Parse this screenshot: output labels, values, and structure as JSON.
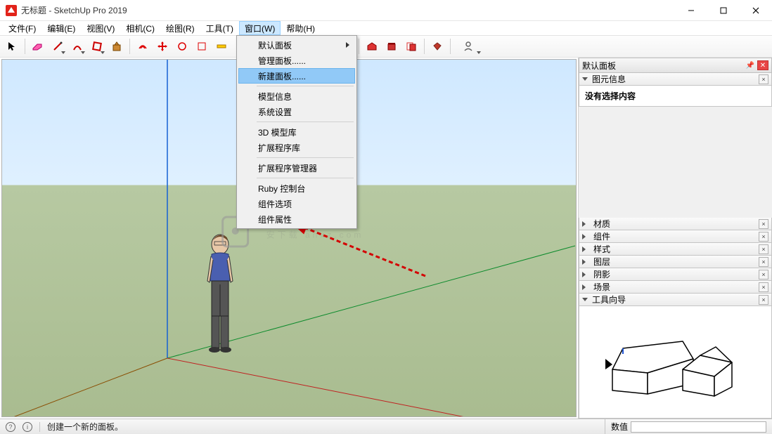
{
  "title": "无标题 - SketchUp Pro 2019",
  "menubar": [
    "文件(F)",
    "编辑(E)",
    "视图(V)",
    "相机(C)",
    "绘图(R)",
    "工具(T)",
    "窗口(W)",
    "帮助(H)"
  ],
  "menubar_open_index": 6,
  "dropdown": {
    "items": [
      {
        "label": "默认面板",
        "submenu": true
      },
      {
        "label": "管理面板......"
      },
      {
        "label": "新建面板......",
        "hover": true
      },
      {
        "sep": true
      },
      {
        "label": "模型信息"
      },
      {
        "label": "系统设置"
      },
      {
        "sep": true
      },
      {
        "label": "3D 模型库"
      },
      {
        "label": "扩展程序库"
      },
      {
        "sep": true
      },
      {
        "label": "扩展程序管理器"
      },
      {
        "sep": true
      },
      {
        "label": "Ruby 控制台"
      },
      {
        "label": "组件选项"
      },
      {
        "label": "组件属性"
      }
    ]
  },
  "panels": {
    "tray_title": "默认面板",
    "entity_info": {
      "title": "图元信息",
      "body": "没有选择内容"
    },
    "sections": [
      {
        "title": "材质"
      },
      {
        "title": "组件"
      },
      {
        "title": "样式"
      },
      {
        "title": "图层"
      },
      {
        "title": "阴影"
      },
      {
        "title": "场景"
      }
    ],
    "instructor": {
      "title": "工具向导"
    }
  },
  "statusbar": {
    "hint": "创建一个新的面板。",
    "value_label": "数值"
  },
  "watermark": "安下载 anxz.com"
}
